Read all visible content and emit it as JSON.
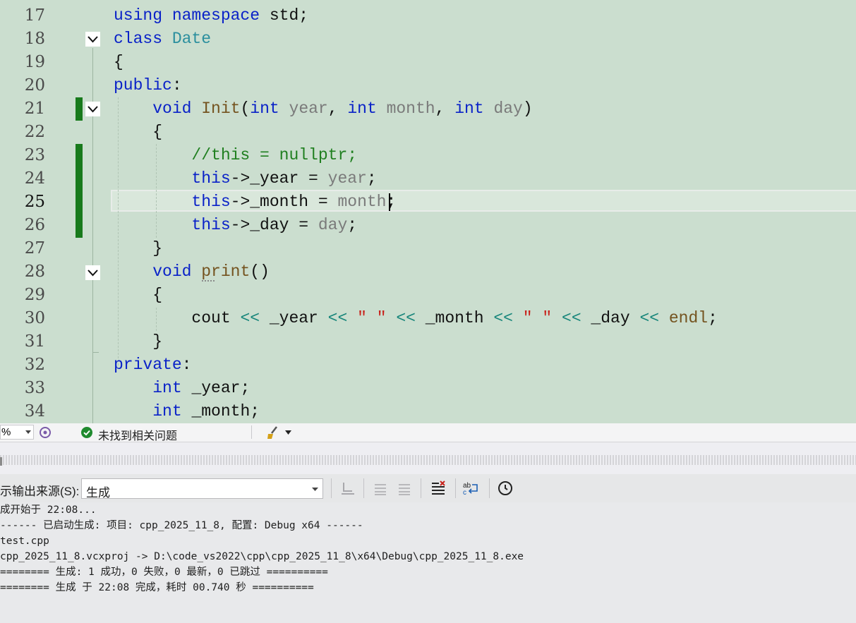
{
  "editor": {
    "lines": [
      {
        "num": "17",
        "tokens": [
          {
            "t": "using namespace",
            "c": "kw"
          },
          {
            "t": " std;"
          }
        ]
      },
      {
        "num": "18",
        "tokens": [
          {
            "t": "class",
            "c": "kw"
          },
          {
            "t": " "
          },
          {
            "t": "Date",
            "c": "ty"
          }
        ]
      },
      {
        "num": "19",
        "tokens": [
          {
            "t": "{"
          }
        ]
      },
      {
        "num": "20",
        "tokens": [
          {
            "t": "public",
            "c": "kw"
          },
          {
            "t": ":"
          }
        ]
      },
      {
        "num": "21",
        "tokens": [
          {
            "t": "    "
          },
          {
            "t": "void",
            "c": "kw"
          },
          {
            "t": " "
          },
          {
            "t": "Init",
            "c": "fn"
          },
          {
            "t": "("
          },
          {
            "t": "int",
            "c": "kw"
          },
          {
            "t": " "
          },
          {
            "t": "year",
            "c": "pa"
          },
          {
            "t": ", "
          },
          {
            "t": "int",
            "c": "kw"
          },
          {
            "t": " "
          },
          {
            "t": "month",
            "c": "pa"
          },
          {
            "t": ", "
          },
          {
            "t": "int",
            "c": "kw"
          },
          {
            "t": " "
          },
          {
            "t": "day",
            "c": "pa"
          },
          {
            "t": ")"
          }
        ]
      },
      {
        "num": "22",
        "tokens": [
          {
            "t": "    {"
          }
        ]
      },
      {
        "num": "23",
        "tokens": [
          {
            "t": "        "
          },
          {
            "t": "//this = nullptr;",
            "c": "cm"
          }
        ]
      },
      {
        "num": "24",
        "tokens": [
          {
            "t": "        "
          },
          {
            "t": "this",
            "c": "kw"
          },
          {
            "t": "->_year = "
          },
          {
            "t": "year",
            "c": "pa"
          },
          {
            "t": ";"
          }
        ]
      },
      {
        "num": "25",
        "tokens": [
          {
            "t": "        "
          },
          {
            "t": "this",
            "c": "kw"
          },
          {
            "t": "->_month = "
          },
          {
            "t": "month",
            "c": "pa"
          },
          {
            "t": ";"
          }
        ]
      },
      {
        "num": "26",
        "tokens": [
          {
            "t": "        "
          },
          {
            "t": "this",
            "c": "kw"
          },
          {
            "t": "->_day = "
          },
          {
            "t": "day",
            "c": "pa"
          },
          {
            "t": ";"
          }
        ]
      },
      {
        "num": "27",
        "tokens": [
          {
            "t": "    }"
          }
        ]
      },
      {
        "num": "28",
        "tokens": [
          {
            "t": "    "
          },
          {
            "t": "void",
            "c": "kw"
          },
          {
            "t": " "
          },
          {
            "t": "print",
            "c": "fn"
          },
          {
            "t": "()"
          }
        ]
      },
      {
        "num": "29",
        "tokens": [
          {
            "t": "    {"
          }
        ]
      },
      {
        "num": "30",
        "tokens": [
          {
            "t": "        cout "
          },
          {
            "t": "<<",
            "c": "op"
          },
          {
            "t": " _year "
          },
          {
            "t": "<<",
            "c": "op"
          },
          {
            "t": " "
          },
          {
            "t": "\" \"",
            "c": "st"
          },
          {
            "t": " "
          },
          {
            "t": "<<",
            "c": "op"
          },
          {
            "t": " _month "
          },
          {
            "t": "<<",
            "c": "op"
          },
          {
            "t": " "
          },
          {
            "t": "\" \"",
            "c": "st"
          },
          {
            "t": " "
          },
          {
            "t": "<<",
            "c": "op"
          },
          {
            "t": " _day "
          },
          {
            "t": "<<",
            "c": "op"
          },
          {
            "t": " "
          },
          {
            "t": "endl",
            "c": "fn"
          },
          {
            "t": ";"
          }
        ]
      },
      {
        "num": "31",
        "tokens": [
          {
            "t": "    }"
          }
        ]
      },
      {
        "num": "32",
        "tokens": [
          {
            "t": "private",
            "c": "kw"
          },
          {
            "t": ":"
          }
        ]
      },
      {
        "num": "33",
        "tokens": [
          {
            "t": "    "
          },
          {
            "t": "int",
            "c": "kw"
          },
          {
            "t": " _year;"
          }
        ]
      },
      {
        "num": "34",
        "tokens": [
          {
            "t": "    "
          },
          {
            "t": "int",
            "c": "kw"
          },
          {
            "t": " _month;"
          }
        ]
      }
    ],
    "current_line": "25"
  },
  "statusbar": {
    "zoom_suffix": "%",
    "issues_text": "未找到相关问题"
  },
  "output_panel": {
    "source_label": "示输出来源(S):",
    "source_value": "生成",
    "lines": [
      "成开始于 22:08...",
      "------ 已启动生成: 项目: cpp_2025_11_8, 配置: Debug x64 ------",
      "test.cpp",
      "cpp_2025_11_8.vcxproj -> D:\\code_vs2022\\cpp\\cpp_2025_11_8\\x64\\Debug\\cpp_2025_11_8.exe",
      "======== 生成: 1 成功，0 失败，0 最新，0 已跳过 ==========",
      "======== 生成 于 22:08 完成，耗时 00.740 秒 =========="
    ]
  },
  "colors": {
    "editor_bg": "#cbdecf",
    "keyword": "#0a22c8",
    "type": "#2b8f9e",
    "param": "#7a7a7a",
    "comment": "#1f7f1f",
    "change_bar": "#187a1c",
    "string": "#c8221b"
  }
}
